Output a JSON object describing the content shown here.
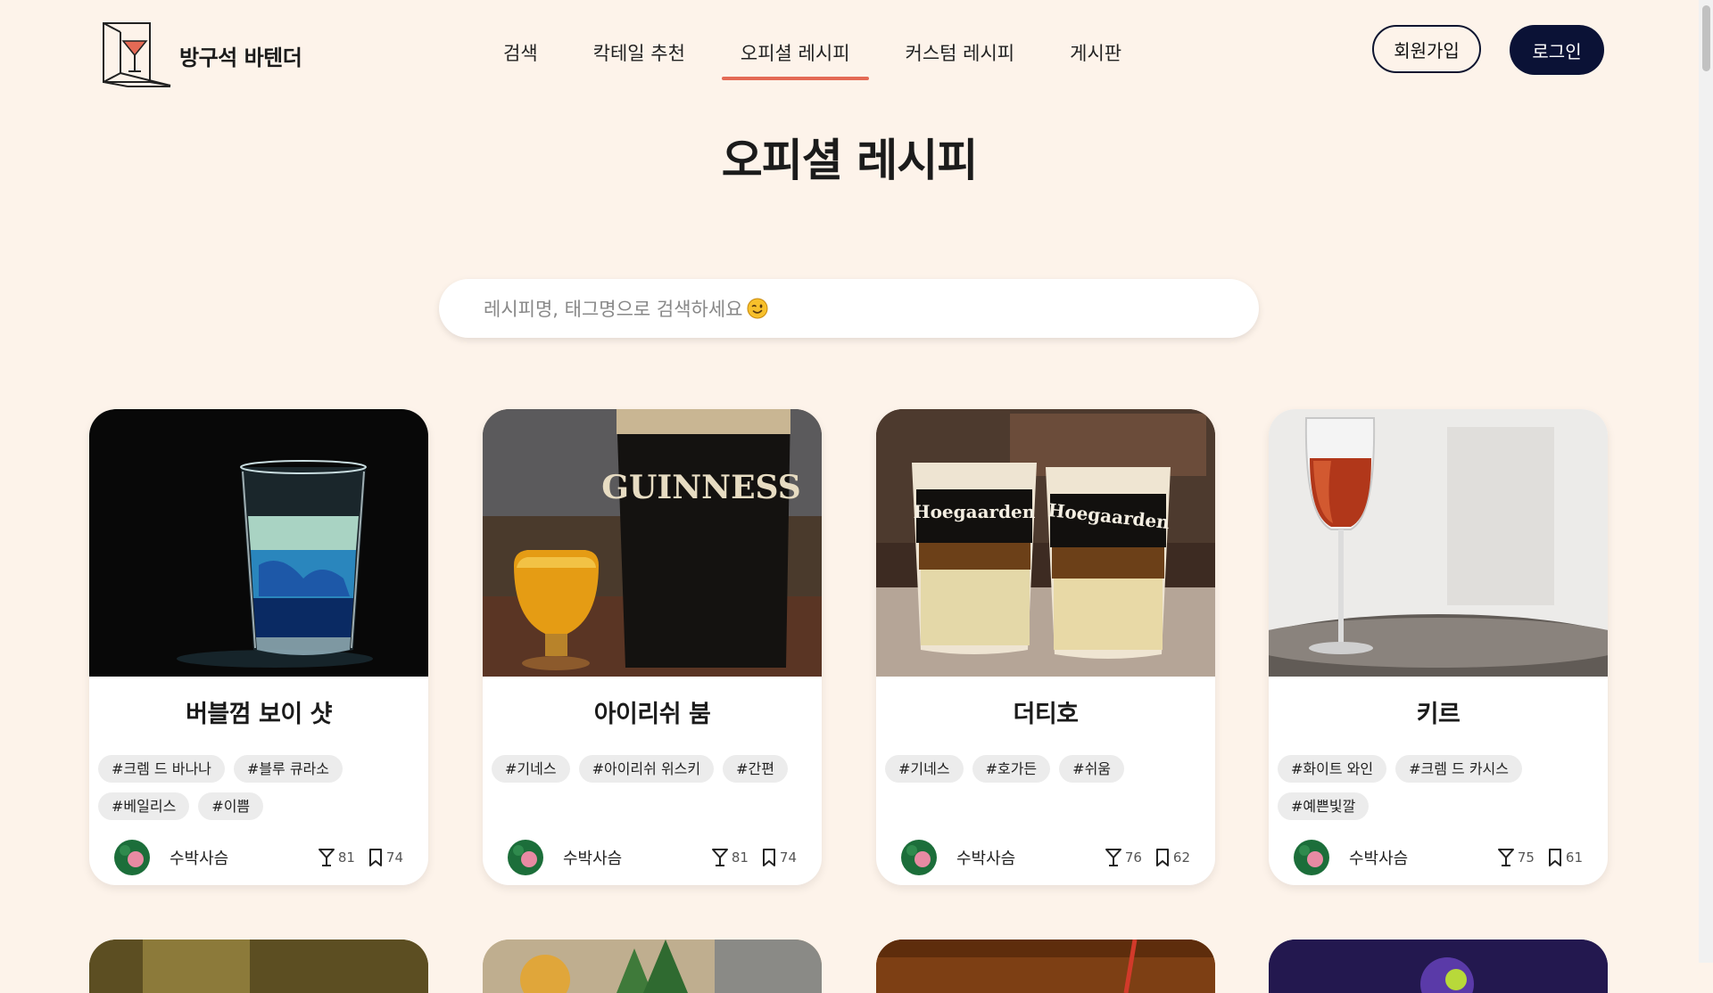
{
  "brand": {
    "name": "방구석 바텐더",
    "icon": "cocktail-cube-icon"
  },
  "nav": [
    {
      "label": "검색"
    },
    {
      "label": "칵테일 추천"
    },
    {
      "label": "오피셜 레시피",
      "active": true
    },
    {
      "label": "커스텀 레시피"
    },
    {
      "label": "게시판"
    }
  ],
  "auth": {
    "signup_label": "회원가입",
    "login_label": "로그인"
  },
  "page": {
    "title": "오피셜 레시피"
  },
  "search": {
    "placeholder": "레시피명, 태그명으로 검색하세요",
    "emoji": "winking-face-icon"
  },
  "colors": {
    "background": "#fdf3ea",
    "accent": "#e46a55",
    "navy": "#0b1236"
  },
  "cards": [
    {
      "title": "버블껌 보이 샷",
      "tags": [
        "#크렘 드 바나나",
        "#블루 큐라소",
        "#베일리스",
        "#이쁨"
      ],
      "author": "수박사슴",
      "likes": "81",
      "bookmarks": "74"
    },
    {
      "title": "아이리쉬 붐",
      "tags": [
        "#기네스",
        "#아이리쉬 위스키",
        "#간편"
      ],
      "author": "수박사슴",
      "likes": "81",
      "bookmarks": "74"
    },
    {
      "title": "더티호",
      "tags": [
        "#기네스",
        "#호가든",
        "#쉬움"
      ],
      "author": "수박사슴",
      "likes": "76",
      "bookmarks": "62"
    },
    {
      "title": "키르",
      "tags": [
        "#화이트 와인",
        "#크렘 드 카시스",
        "#예쁜빛깔"
      ],
      "author": "수박사슴",
      "likes": "75",
      "bookmarks": "61"
    }
  ],
  "photo_text": {
    "guinness": "GUINNESS",
    "hoegaarden": "Hoegaarden"
  }
}
